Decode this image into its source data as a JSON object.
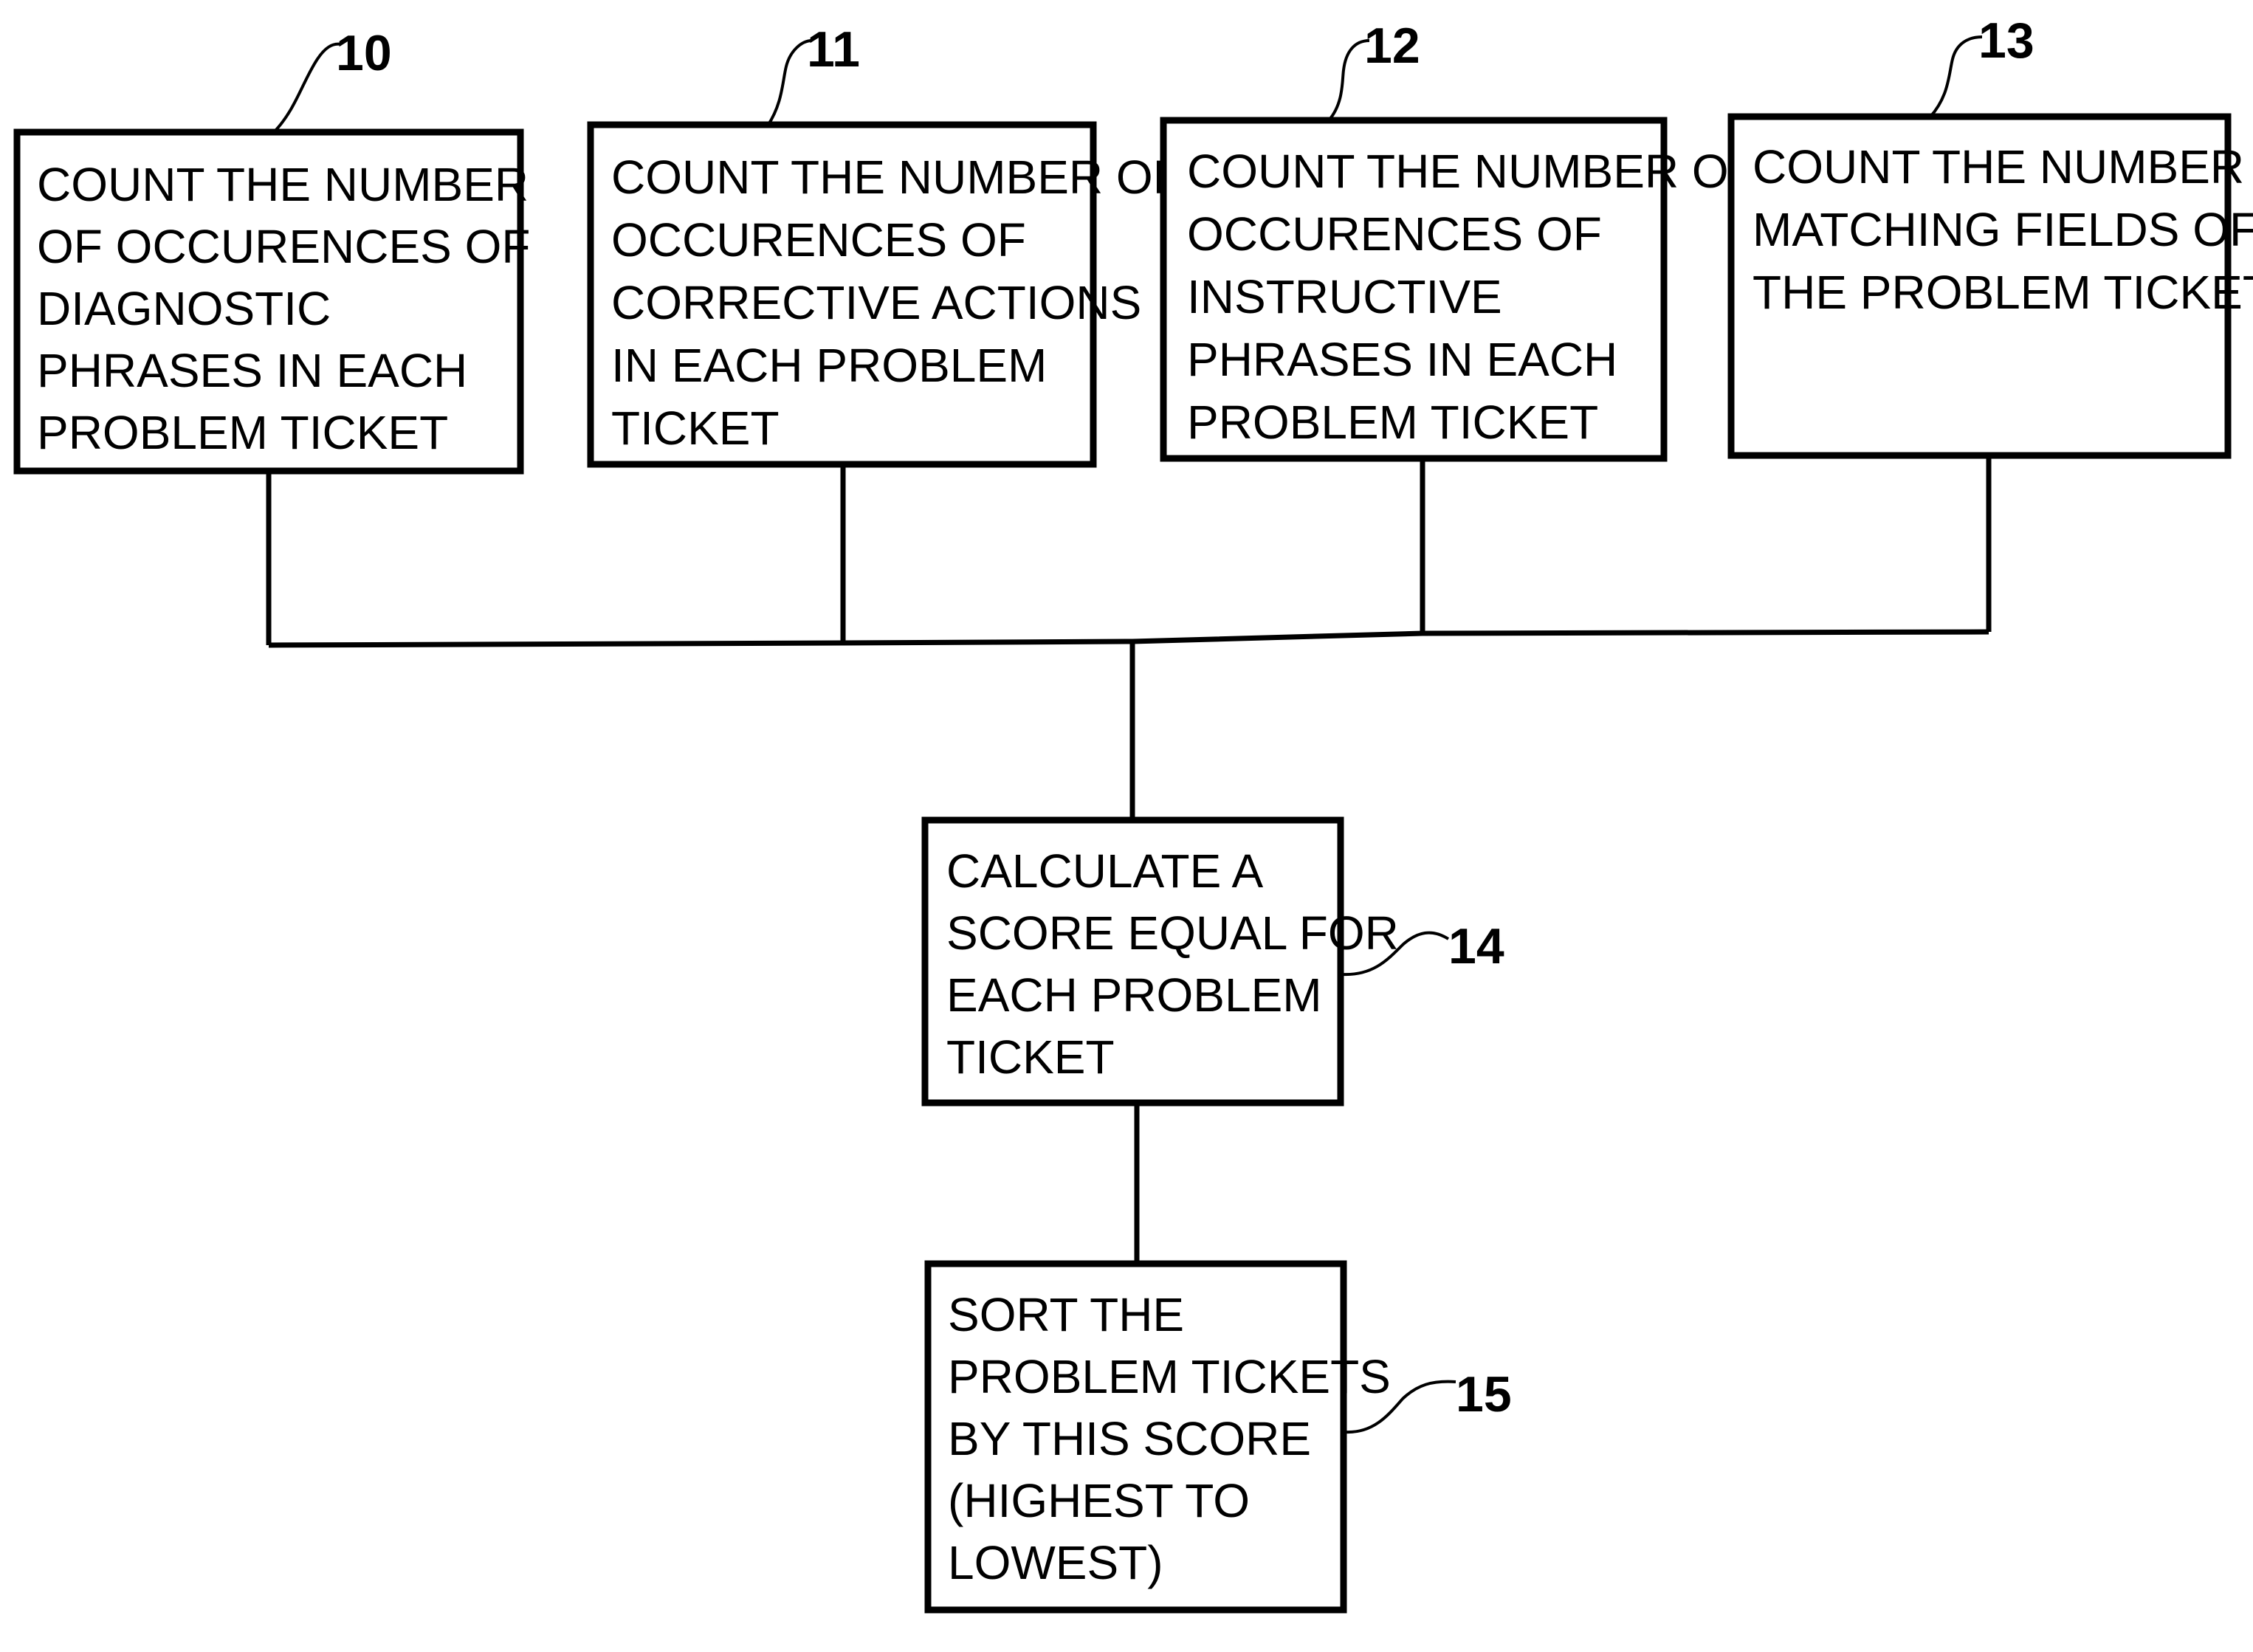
{
  "diagram": {
    "type": "flowchart",
    "boxes": [
      {
        "id": "10",
        "ref": "10",
        "lines": [
          "COUNT THE NUMBER",
          "OF OCCURENCES OF",
          "DIAGNOSTIC",
          "PHRASES IN EACH",
          "PROBLEM TICKET"
        ]
      },
      {
        "id": "11",
        "ref": "11",
        "lines": [
          "COUNT THE NUMBER OF",
          "OCCURENCES OF",
          "CORRECTIVE ACTIONS",
          "IN EACH PROBLEM",
          "TICKET"
        ]
      },
      {
        "id": "12",
        "ref": "12",
        "lines": [
          "COUNT THE NUMBER OF",
          "OCCURENCES OF",
          "INSTRUCTIVE",
          "PHRASES IN EACH",
          "PROBLEM TICKET"
        ]
      },
      {
        "id": "13",
        "ref": "13",
        "lines": [
          "COUNT THE NUMBER OF",
          "MATCHING FIELDS OF",
          "THE PROBLEM TICKET"
        ]
      },
      {
        "id": "14",
        "ref": "14",
        "lines": [
          "CALCULATE A",
          "SCORE EQUAL FOR",
          "EACH PROBLEM",
          "TICKET"
        ]
      },
      {
        "id": "15",
        "ref": "15",
        "lines": [
          "SORT THE",
          "PROBLEM TICKETS",
          "BY THIS SCORE",
          "(HIGHEST TO",
          "LOWEST)"
        ]
      }
    ],
    "edges": [
      {
        "from": "10",
        "to": "14"
      },
      {
        "from": "11",
        "to": "14"
      },
      {
        "from": "12",
        "to": "14"
      },
      {
        "from": "13",
        "to": "14"
      },
      {
        "from": "14",
        "to": "15"
      }
    ]
  }
}
